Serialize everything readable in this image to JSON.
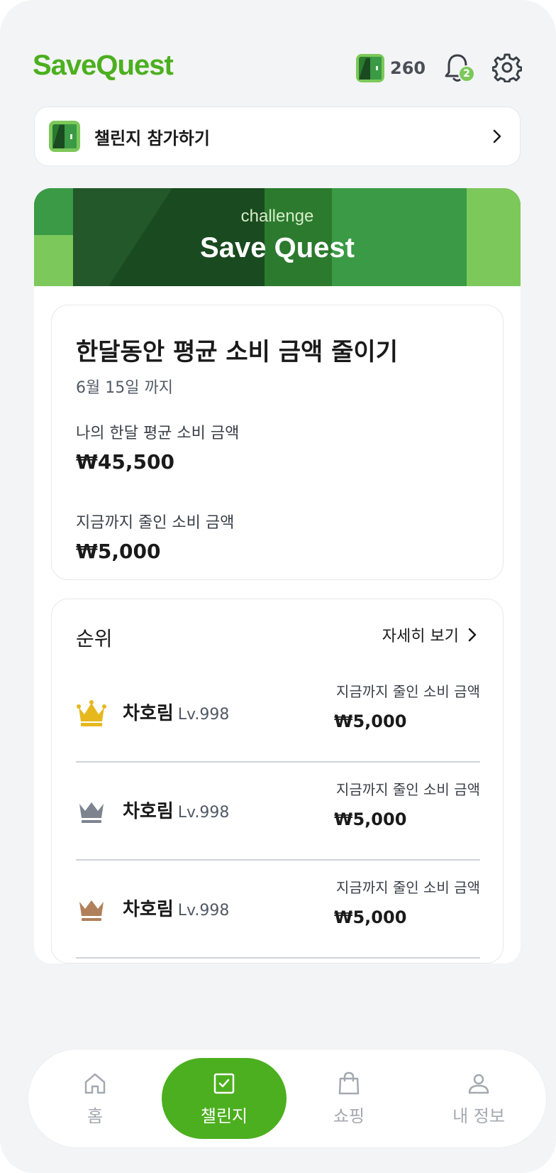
{
  "app": {
    "name": "SaveQuest"
  },
  "header": {
    "points": "260",
    "notification_count": "2"
  },
  "join": {
    "label": "챌린지 참가하기"
  },
  "banner": {
    "subtitle": "challenge",
    "title": "Save Quest"
  },
  "challenge": {
    "title": "한달동안 평균 소비 금액 줄이기",
    "deadline": "6월 15일 까지",
    "avg_label": "나의 한달 평균 소비 금액",
    "avg_value": "₩45,500",
    "saved_label": "지금까지 줄인 소비 금액",
    "saved_value": "₩5,000"
  },
  "ranking": {
    "title": "순위",
    "more_label": "자세히 보기",
    "rows": [
      {
        "name": "차호림",
        "level": "Lv.998",
        "label": "지금까지 줄인 소비 금액",
        "value": "₩5,000"
      },
      {
        "name": "차호림",
        "level": "Lv.998",
        "label": "지금까지 줄인 소비 금액",
        "value": "₩5,000"
      },
      {
        "name": "차호림",
        "level": "Lv.998",
        "label": "지금까지 줄인 소비 금액",
        "value": "₩5,000"
      }
    ]
  },
  "nav": {
    "tabs": [
      {
        "label": "홈",
        "icon": "home-icon"
      },
      {
        "label": "챌린지",
        "icon": "checkbox-icon",
        "active": true
      },
      {
        "label": "쇼핑",
        "icon": "shopping-bag-icon"
      },
      {
        "label": "내 정보",
        "icon": "person-icon"
      }
    ]
  },
  "colors": {
    "brand": "#4caf1f",
    "gold": "#e6b81e",
    "silver": "#7d8490",
    "bronze": "#b0805a"
  }
}
